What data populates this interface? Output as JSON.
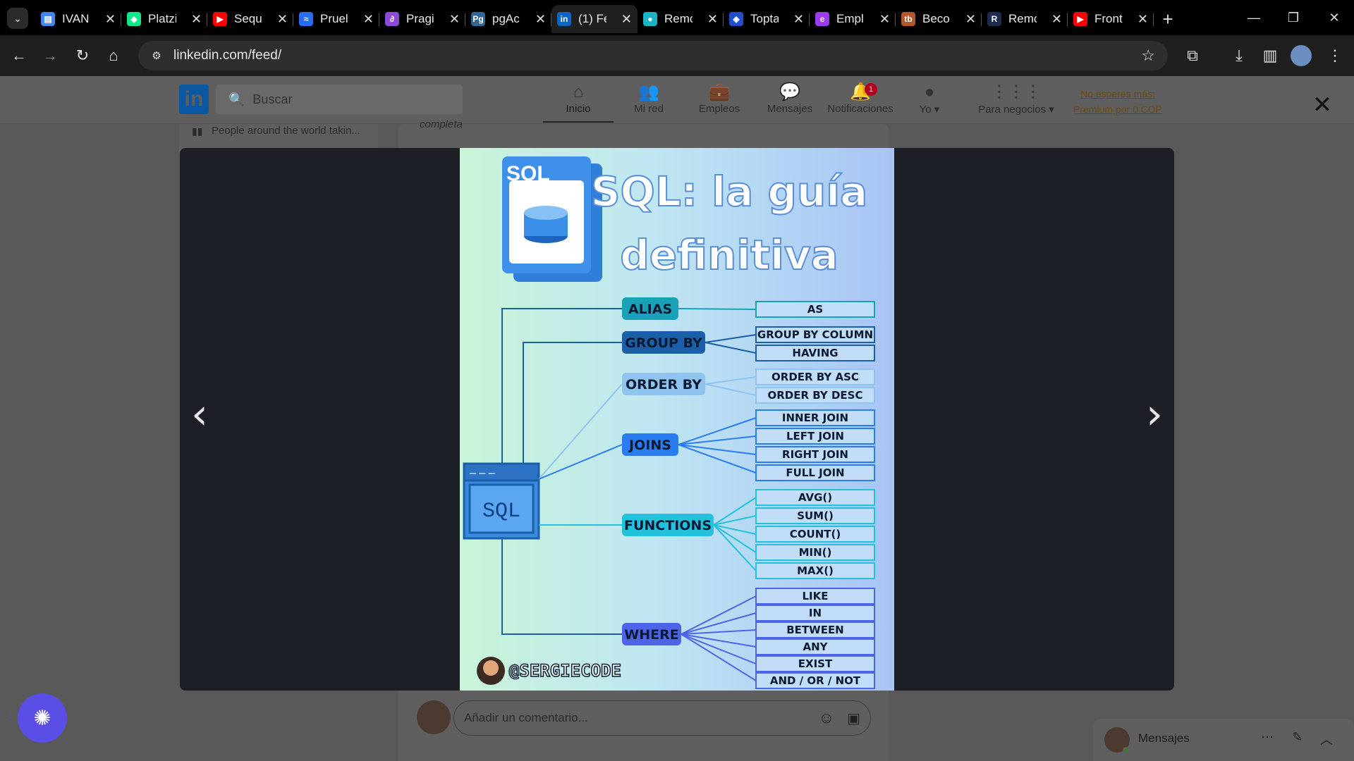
{
  "browser": {
    "tabs": [
      {
        "title": "IVAN",
        "color": "#4285f4",
        "glyph": "▤"
      },
      {
        "title": "Platzi",
        "color": "#0ae98a",
        "glyph": "◆"
      },
      {
        "title": "Sequ",
        "color": "#ff0000",
        "glyph": "▶"
      },
      {
        "title": "Pruel",
        "color": "#2a6df5",
        "glyph": "≈"
      },
      {
        "title": "Pragi",
        "color": "#8b4bd6",
        "glyph": "∂"
      },
      {
        "title": "pgAc",
        "color": "#336791",
        "glyph": "Pg"
      },
      {
        "title": "(1) Fe",
        "color": "#0a66c2",
        "glyph": "in",
        "active": true
      },
      {
        "title": "Remo",
        "color": "#19b5c5",
        "glyph": "●"
      },
      {
        "title": "Topta",
        "color": "#204ecf",
        "glyph": "◈"
      },
      {
        "title": "Empl",
        "color": "#9b3cf0",
        "glyph": "e"
      },
      {
        "title": "Beco",
        "color": "#b3562b",
        "glyph": "tb"
      },
      {
        "title": "Remo",
        "color": "#1d2b4f",
        "glyph": "R"
      },
      {
        "title": "Front",
        "color": "#ff0000",
        "glyph": "▶"
      }
    ],
    "url": "linkedin.com/feed/"
  },
  "linkedin": {
    "search_placeholder": "Buscar",
    "nav": [
      {
        "label": "Inicio",
        "icon": "home-icon",
        "glyph": "⌂",
        "active": true
      },
      {
        "label": "Mi red",
        "icon": "network-icon",
        "glyph": "👥"
      },
      {
        "label": "Empleos",
        "icon": "briefcase-icon",
        "glyph": "💼"
      },
      {
        "label": "Mensajes",
        "icon": "chat-icon",
        "glyph": "💬"
      },
      {
        "label": "Notificaciones",
        "icon": "bell-icon",
        "glyph": "🔔",
        "badge": "1"
      },
      {
        "label": "Yo ▾",
        "icon": "avatar-icon",
        "glyph": "●"
      }
    ],
    "business_label": "Para negocios ▾",
    "premium_line1": "No esperes más:",
    "premium_line2": "Premium por 0 COP",
    "sidebar_fragment": "People around the world takin...",
    "feed_fragment": "completa",
    "comment_placeholder": "Añadir un comentario...",
    "messaging_label": "Mensajes"
  },
  "poster": {
    "title_line1": "SQL: la guía",
    "title_line2": "definitiva",
    "doc_label": "SQL",
    "db_label": "SQL",
    "author": "@SERGIECODE",
    "branches": [
      {
        "label": "ALIAS",
        "color": "#17a2b8",
        "children": [
          "AS"
        ]
      },
      {
        "label": "GROUP BY",
        "color": "#1b5fa8",
        "children": [
          "GROUP BY COLUMN",
          "HAVING"
        ]
      },
      {
        "label": "ORDER BY",
        "color": "#8fc4f0",
        "children": [
          "ORDER BY ASC",
          "ORDER BY DESC"
        ]
      },
      {
        "label": "JOINS",
        "color": "#2a7df0",
        "children": [
          "INNER JOIN",
          "LEFT JOIN",
          "RIGHT JOIN",
          "FULL JOIN"
        ]
      },
      {
        "label": "FUNCTIONS",
        "color": "#22c1dc",
        "children": [
          "AVG()",
          "SUM()",
          "COUNT()",
          "MIN()",
          "MAX()"
        ]
      },
      {
        "label": "WHERE",
        "color": "#4d64e8",
        "children": [
          "LIKE",
          "IN",
          "BETWEEN",
          "ANY",
          "EXIST",
          "AND / OR / NOT"
        ]
      }
    ]
  }
}
